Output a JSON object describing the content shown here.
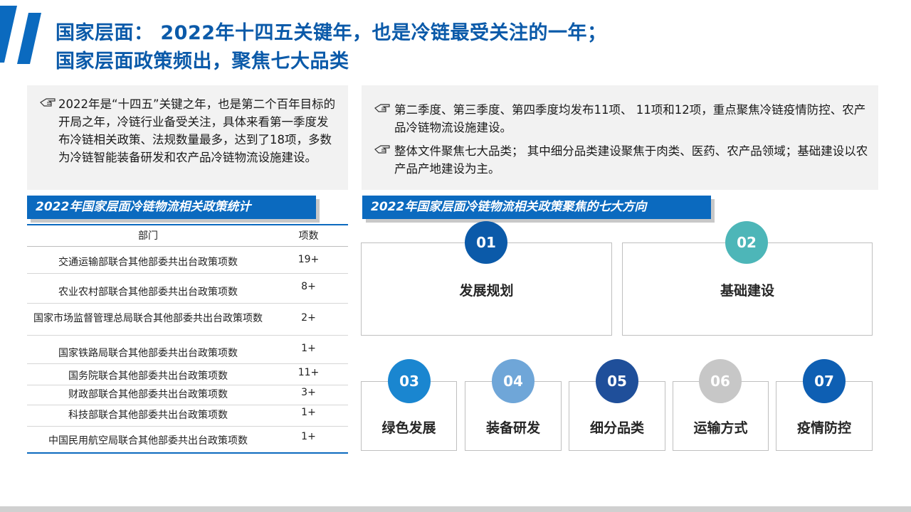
{
  "title": {
    "line1": "国家层面：   2022年十四五关键年，也是冷链最受关注的一年；",
    "line2": "国家层面政策频出，聚焦七大品类"
  },
  "intro_left": "2022年是“十四五”关键之年，也是第二个百年目标的开局之年，冷链行业备受关注，具体来看第一季度发布冷链相关政策、法规数量最多，达到了18项，多数为冷链智能装备研发和农产品冷链物流设施建设。",
  "intro_right": [
    "第二季度、第三季度、第四季度均发布11项、 11项和12项，重点聚焦冷链疫情防控、农产品冷链物流设施建设。",
    "整体文件聚焦七大品类；  其中细分品类建设聚焦于肉类、医药、农产品领域；基础建设以农产品产地建设为主。"
  ],
  "table_section_title": "2022年国家层面冷链物流相关政策统计",
  "directions_section_title": "2022年国家层面冷链物流相关政策聚焦的七大方向",
  "table": {
    "headers": [
      "部门",
      "项数"
    ],
    "rows": [
      {
        "dept": "交通运输部联合其他部委共出台政策项数",
        "count": "19+"
      },
      {
        "dept": "农业农村部联合其他部委共出台政策项数",
        "count": "8+"
      },
      {
        "dept": "国家市场监督管理总局联合其他部委共出台政策项数",
        "count": "2+"
      },
      {
        "dept": "国家铁路局联合其他部委共出台政策项数",
        "count": "1+"
      },
      {
        "dept": "国务院联合其他部委共出台政策项数",
        "count": "11+"
      },
      {
        "dept": "财政部联合其他部委共出台政策项数",
        "count": "3+"
      },
      {
        "dept": "科技部联合其他部委共出台政策项数",
        "count": "1+"
      },
      {
        "dept": "中国民用航空局联合其他部委共出台政策项数",
        "count": "1+"
      }
    ]
  },
  "directions": [
    {
      "num": "01",
      "label": "发展规划",
      "color": "#0b5aa9"
    },
    {
      "num": "02",
      "label": "基础建设",
      "color": "#4db6b8"
    },
    {
      "num": "03",
      "label": "绿色发展",
      "color": "#1a86d0"
    },
    {
      "num": "04",
      "label": "装备研发",
      "color": "#6fa6d8"
    },
    {
      "num": "05",
      "label": "细分品类",
      "color": "#1f4f9a"
    },
    {
      "num": "06",
      "label": "运输方式",
      "color": "#c7c7c7"
    },
    {
      "num": "07",
      "label": "疫情防控",
      "color": "#0e5fb3"
    }
  ],
  "icons": {
    "bullet": "pointing-hand-icon",
    "header_deco": "diagonal-stripes-icon"
  }
}
